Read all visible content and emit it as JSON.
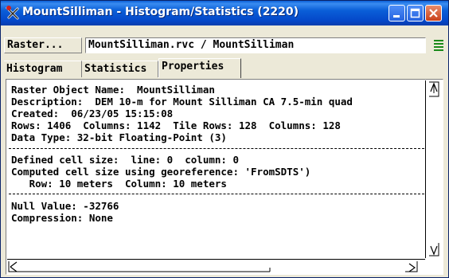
{
  "window": {
    "title": "MountSilliman - Histogram/Statistics (2220)"
  },
  "toolbar": {
    "raster_button_label": "Raster...",
    "raster_value": "MountSilliman.rvc / MountSilliman"
  },
  "tabs": [
    {
      "label": "Histogram"
    },
    {
      "label": "Statistics"
    },
    {
      "label": "Properties"
    }
  ],
  "properties": {
    "lines": [
      "Raster Object Name:  MountSilliman",
      "Description:  DEM 10-m for Mount Silliman CA 7.5-min quad",
      "Created:  06/23/05 15:15:08",
      "Rows: 1406  Columns: 1142  Tile Rows: 128  Columns: 128",
      "Data Type: 32-bit Floating-Point (3)",
      "Defined cell size:  line: 0  column: 0",
      "Computed cell size using georeference: 'FromSDTS')",
      "   Row: 10 meters  Column: 10 meters",
      "Null Value: -32766",
      "Compression: None"
    ]
  },
  "colors": {
    "titlebar": "#0a5fd8",
    "close_button": "#c9401a",
    "window_bg": "#ece9d8"
  },
  "icons": {
    "app": "app-icon",
    "minimize": "minimize-icon",
    "maximize": "maximize-icon",
    "close": "close-icon",
    "menu": "menu-icon"
  }
}
